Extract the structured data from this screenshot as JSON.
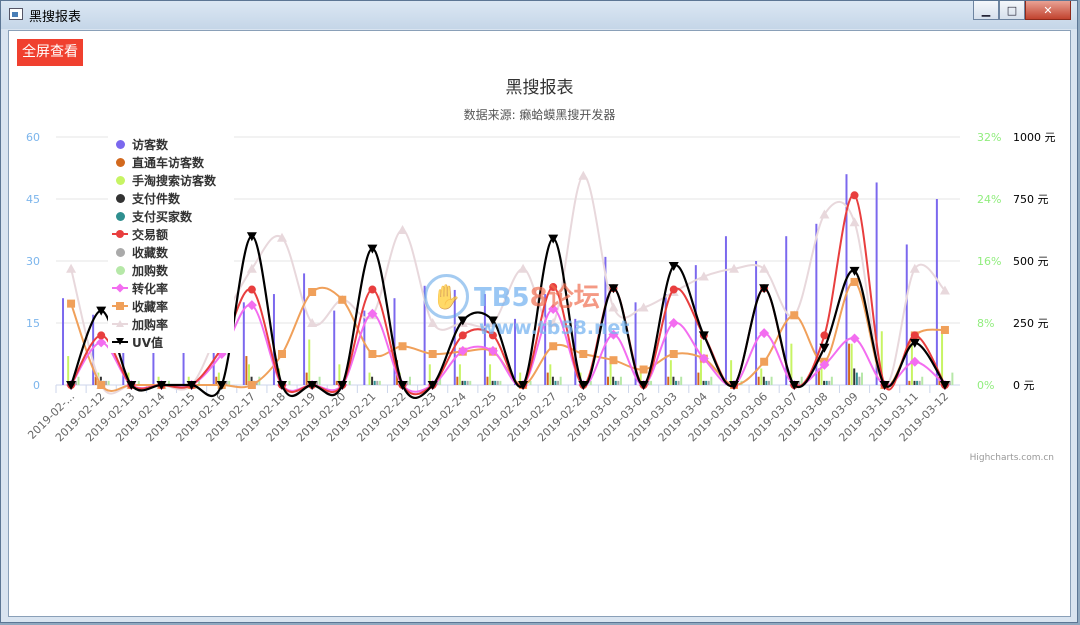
{
  "window": {
    "title": "黑搜报表",
    "controls": [
      "minimize",
      "maximize",
      "close"
    ]
  },
  "toolbar": {
    "fullscreen_label": "全屏查看"
  },
  "credits": "Highcharts.com.cn",
  "watermark": {
    "text_a": "TB5",
    "text_b": "8论坛",
    "url": "www.tb58.net"
  },
  "chart_data": {
    "type": "bar",
    "title": "黑搜报表",
    "subtitle": "数据来源: 癞蛤蟆黑搜开发器",
    "categories": [
      "2019-02-...",
      "2019-02-12",
      "2019-02-13",
      "2019-02-14",
      "2019-02-15",
      "2019-02-16",
      "2019-02-17",
      "2019-02-18",
      "2019-02-19",
      "2019-02-20",
      "2019-02-21",
      "2019-02-22",
      "2019-02-23",
      "2019-02-24",
      "2019-02-25",
      "2019-02-26",
      "2019-02-27",
      "2019-02-28",
      "2019-03-01",
      "2019-03-02",
      "2019-03-03",
      "2019-03-04",
      "2019-03-05",
      "2019-03-06",
      "2019-03-07",
      "2019-03-08",
      "2019-03-09",
      "2019-03-10",
      "2019-03-11",
      "2019-03-12"
    ],
    "axes": {
      "y_left": {
        "min": 0,
        "max": 60,
        "ticks": [
          "0",
          "15",
          "30",
          "45",
          "60"
        ],
        "color": "#7cb5ec"
      },
      "y_pct": {
        "min": 0,
        "max": 32,
        "ticks": [
          "0%",
          "8%",
          "16%",
          "24%",
          "32%"
        ],
        "color": "#90ed7d"
      },
      "y_money": {
        "min": 0,
        "max": 1000,
        "ticks": [
          "0 元",
          "250 元",
          "500 元",
          "750 元",
          "1000 元"
        ],
        "color": "#000000"
      }
    },
    "legend_position": "top-left",
    "series": [
      {
        "name": "访客数",
        "kind": "column",
        "axis": "y_left",
        "color": "#7b68ee",
        "values": [
          21,
          17,
          16,
          9,
          10,
          13,
          20,
          22,
          27,
          18,
          18,
          21,
          24,
          23,
          22,
          16,
          22,
          16,
          31,
          20,
          22,
          29,
          36,
          30,
          36,
          39,
          51,
          49,
          34,
          45
        ]
      },
      {
        "name": "直通车访客数",
        "kind": "column",
        "axis": "y_left",
        "color": "#d2691e",
        "values": [
          0,
          2,
          0,
          0,
          0,
          2,
          7,
          0,
          3,
          1,
          0,
          6,
          0,
          2,
          2,
          0,
          3,
          0,
          2,
          0,
          2,
          3,
          0,
          2,
          0,
          4,
          10,
          0,
          1,
          2
        ]
      },
      {
        "name": "手淘搜索访客数",
        "kind": "column",
        "axis": "y_left",
        "color": "#c7f464",
        "values": [
          7,
          3,
          3,
          2,
          2,
          3,
          5,
          4,
          11,
          5,
          3,
          3,
          5,
          5,
          5,
          3,
          5,
          3,
          6,
          4,
          6,
          11,
          6,
          4,
          10,
          6,
          10,
          13,
          10,
          14
        ]
      },
      {
        "name": "支付件数",
        "kind": "column",
        "axis": "y_left",
        "color": "#333333",
        "values": [
          0,
          2,
          0,
          0,
          0,
          0,
          2,
          0,
          0,
          0,
          2,
          0,
          0,
          1,
          1,
          0,
          2,
          0,
          2,
          0,
          2,
          1,
          0,
          2,
          0,
          1,
          4,
          0,
          1,
          0
        ]
      },
      {
        "name": "支付买家数",
        "kind": "column",
        "axis": "y_left",
        "color": "#2f8f8f",
        "values": [
          0,
          1,
          0,
          0,
          0,
          0,
          1,
          0,
          0,
          0,
          1,
          0,
          0,
          1,
          1,
          0,
          1,
          0,
          1,
          0,
          1,
          1,
          0,
          1,
          0,
          1,
          3,
          0,
          1,
          0
        ]
      },
      {
        "name": "交易额",
        "kind": "spline",
        "axis": "y_money",
        "color": "#e83e3e",
        "marker": "circle",
        "values": [
          0,
          200,
          0,
          0,
          0,
          150,
          385,
          0,
          0,
          0,
          385,
          0,
          0,
          200,
          200,
          0,
          395,
          0,
          390,
          0,
          385,
          200,
          0,
          390,
          0,
          200,
          765,
          0,
          200,
          0
        ]
      },
      {
        "name": "收藏数",
        "kind": "column",
        "axis": "y_left",
        "color": "#aaaaaa",
        "values": [
          1,
          1,
          0,
          0,
          0,
          1,
          1,
          0,
          1,
          0,
          1,
          1,
          1,
          1,
          1,
          0,
          1,
          0,
          1,
          1,
          1,
          1,
          0,
          1,
          1,
          1,
          2,
          0,
          1,
          1
        ]
      },
      {
        "name": "加购数",
        "kind": "column",
        "axis": "y_left",
        "color": "#b6e8a8",
        "values": [
          2,
          1,
          1,
          1,
          1,
          1,
          2,
          1,
          2,
          1,
          1,
          2,
          2,
          1,
          1,
          1,
          2,
          1,
          2,
          1,
          2,
          2,
          1,
          2,
          2,
          2,
          3,
          1,
          2,
          3
        ]
      },
      {
        "name": "转化率",
        "kind": "spline",
        "axis": "y_pct",
        "color": "#f36df0",
        "marker": "diamond",
        "values": [
          0,
          5.5,
          0,
          0,
          0,
          4,
          10.3,
          0,
          0,
          0,
          9.2,
          0,
          0,
          4.4,
          4.4,
          0,
          9.8,
          0,
          6.5,
          0,
          8,
          3.4,
          0,
          6.7,
          0,
          2.6,
          6,
          0,
          3,
          0
        ]
      },
      {
        "name": "收藏率",
        "kind": "spline",
        "axis": "y_pct",
        "color": "#f0a05a",
        "marker": "square",
        "values": [
          10.5,
          0,
          0,
          0,
          0,
          0,
          0,
          4,
          12,
          11,
          4,
          5,
          4,
          4.3,
          4.3,
          0,
          5,
          4,
          3.2,
          2,
          4,
          3.4,
          0,
          3,
          9,
          3,
          13.3,
          0,
          6.4,
          7.1
        ]
      },
      {
        "name": "加购率",
        "kind": "spline",
        "axis": "y_pct",
        "color": "#e8d8dc",
        "marker": "triangle",
        "values": [
          15,
          0,
          0,
          0,
          0,
          8,
          15,
          19,
          8,
          11,
          9,
          20,
          8,
          8,
          8,
          15,
          8,
          27,
          10,
          10,
          12,
          14,
          15,
          15,
          9,
          22,
          21,
          0,
          15,
          12.2
        ]
      },
      {
        "name": "UV值",
        "kind": "spline",
        "axis": "y_money",
        "color": "#000000",
        "marker": "triangle-down",
        "values": [
          0,
          300,
          0,
          0,
          0,
          0,
          600,
          0,
          0,
          0,
          550,
          0,
          0,
          260,
          260,
          0,
          590,
          0,
          390,
          0,
          480,
          200,
          0,
          390,
          0,
          150,
          460,
          0,
          170,
          0
        ]
      }
    ]
  }
}
